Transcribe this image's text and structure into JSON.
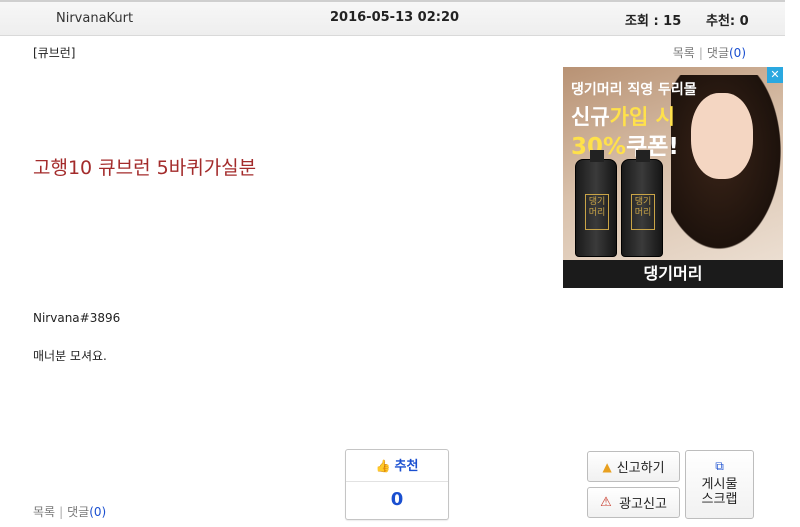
{
  "header": {
    "author": "NirvanaKurt",
    "datetime": "2016-05-13 02:20",
    "views_label": "조회 : 15",
    "recommend_label": "추천: 0"
  },
  "category": "[큐브런]",
  "links": {
    "list": "목록",
    "comments": "댓글",
    "comment_count": "(0)"
  },
  "post": {
    "title": "고행10 큐브런 5바퀴가실분",
    "line1": "Nirvana#3896",
    "line2": "매너분 모셔요."
  },
  "ad": {
    "close": "✕",
    "line1": "댕기머리 직영 두리몰",
    "line2_a": "신규",
    "line2_b": "가입 시",
    "line3_a": "30%",
    "line3_b": "쿠폰!",
    "bottle_label": "댕기\n머리",
    "brand": "댕기머리"
  },
  "recommend": {
    "label": "추천",
    "count": "0"
  },
  "actions": {
    "report": "신고하기",
    "ad_report": "광고신고",
    "scrap_line1": "게시물",
    "scrap_line2": "스크랩"
  },
  "icons": {
    "thumb": "thumbs-up-icon",
    "report": "siren-icon",
    "ad_report": "warning-icon",
    "scrap": "scrap-icon"
  },
  "colors": {
    "title": "#a32b2b",
    "link_accent": "#1a4fd0"
  }
}
